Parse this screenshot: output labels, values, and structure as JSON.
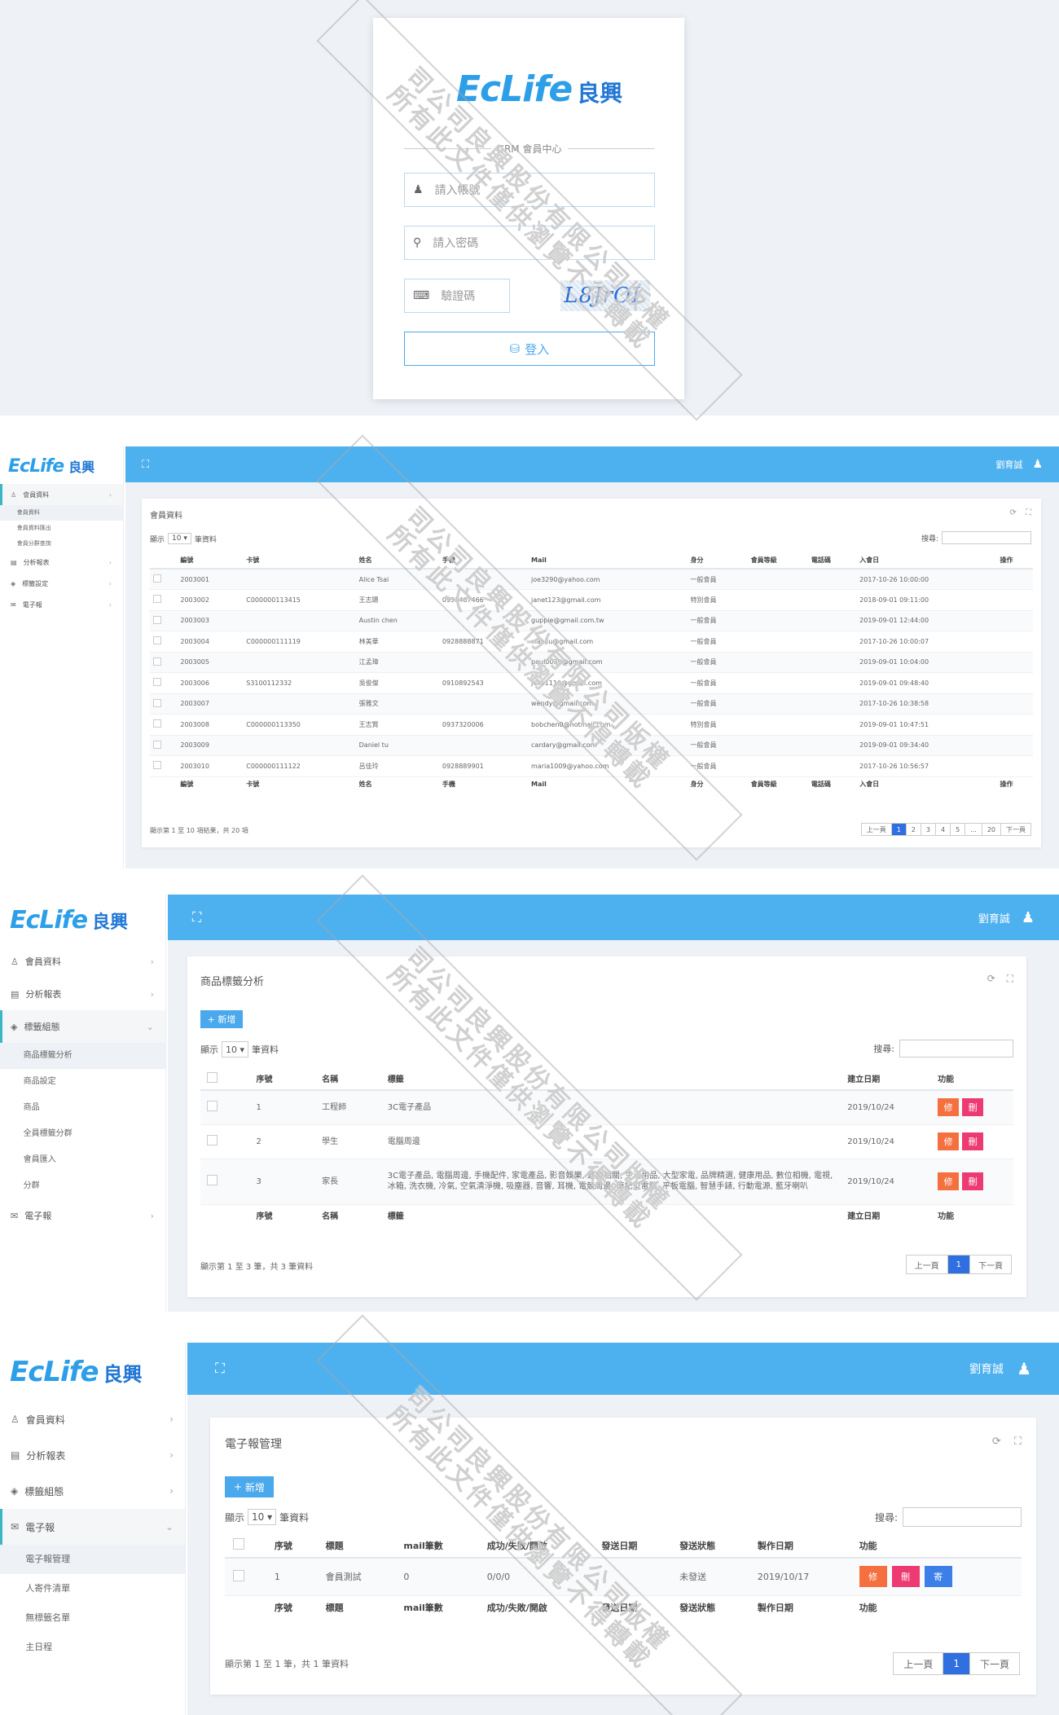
{
  "watermark": {
    "line1": "司公司良興股份有限公司版權",
    "line2": "所有此文件僅供瀏覽不得轉載"
  },
  "login": {
    "logo_en": "EcLife",
    "logo_zh": "良興",
    "section_label": "CRM 會員中心",
    "account_placeholder": "請入帳號",
    "password_placeholder": "請入密碼",
    "captcha_placeholder": "驗證碼",
    "captcha_text": "L8JrOL",
    "login_button": "登入"
  },
  "common": {
    "logo_en": "EcLife",
    "logo_zh": "良興",
    "user_name": "劉育誠"
  },
  "panel2": {
    "menu": [
      {
        "label": "會員資料",
        "active": true
      },
      {
        "label": "分析報表"
      },
      {
        "label": "標籤設定"
      },
      {
        "label": "電子報"
      }
    ],
    "submenu": [
      "會員資料",
      "會員資料匯出",
      "會員分群查詢"
    ],
    "card_title": "會員資料",
    "show_prefix": "顯示",
    "show_value": "10",
    "show_suffix": "筆資料",
    "search_label": "搜尋:",
    "columns": [
      "",
      "編號",
      "卡號",
      "姓名",
      "手機",
      "Mail",
      "身分",
      "會員等級",
      "電話碼",
      "入會日",
      "操作"
    ],
    "footer_columns": [
      "",
      "編號",
      "卡號",
      "姓名",
      "手機",
      "Mail",
      "身分",
      "會員等級",
      "電話碼",
      "入會日",
      "操作"
    ],
    "rows": [
      [
        "",
        "2003001",
        "",
        "Alice Tsai",
        "",
        "joe3290@yahoo.com",
        "一般會員",
        "",
        "",
        "2017-10-26 10:00:00",
        ""
      ],
      [
        "",
        "2003002",
        "C000000113415",
        "王志聰",
        "0933467466",
        "janet123@gmail.com",
        "特別會員",
        "",
        "",
        "2018-09-01 09:11:00",
        ""
      ],
      [
        "",
        "2003003",
        "",
        "Austin chen",
        "",
        "guppie@gmail.com.tw",
        "一般會員",
        "",
        "",
        "2019-09-01 12:44:00",
        ""
      ],
      [
        "",
        "2003004",
        "C000000111119",
        "林美華",
        "0928888871",
        "xiaoliu@gmail.com",
        "一般會員",
        "",
        "",
        "2017-10-26 10:00:07",
        ""
      ],
      [
        "",
        "2003005",
        "",
        "江孟璋",
        "",
        "paul0030@gmail.com",
        "一般會員",
        "",
        "",
        "2019-09-01 10:04:00",
        ""
      ],
      [
        "",
        "2003006",
        "S3100112332",
        "吳俊傑",
        "0910892543",
        "julia1110@gmail.com",
        "一般會員",
        "",
        "",
        "2019-09-01 09:48:40",
        ""
      ],
      [
        "",
        "2003007",
        "",
        "張雅文",
        "",
        "wendy@gmail.com",
        "一般會員",
        "",
        "",
        "2017-10-26 10:38:58",
        ""
      ],
      [
        "",
        "2003008",
        "C000000113350",
        "王志賢",
        "0937320006",
        "bobchen0@hotmail.com",
        "特別會員",
        "",
        "",
        "2019-09-01 10:47:51",
        ""
      ],
      [
        "",
        "2003009",
        "",
        "Daniel tu",
        "",
        "cardary@gmail.com",
        "一般會員",
        "",
        "",
        "2019-09-01 09:34:40",
        ""
      ],
      [
        "",
        "2003010",
        "C000000111122",
        "呂佳玲",
        "0928889901",
        "maria1009@yahoo.com",
        "一般會員",
        "",
        "",
        "2017-10-26 10:56:57",
        ""
      ]
    ],
    "info": "顯示第 1 至 10 項結果，共 20 項",
    "pages": [
      "上一頁",
      "1",
      "2",
      "3",
      "4",
      "5",
      "...",
      "20",
      "下一頁"
    ]
  },
  "panel3": {
    "menu": [
      {
        "label": "會員資料"
      },
      {
        "label": "分析報表"
      },
      {
        "label": "標籤組態",
        "active": true,
        "open": true
      },
      {
        "label": "電子報"
      }
    ],
    "submenu": [
      "商品標籤分析",
      "商品設定",
      "商品",
      "全員標籤分群",
      "會員匯入",
      "分群"
    ],
    "card_title": "商品標籤分析",
    "add_button": "新增",
    "show_prefix": "顯示",
    "show_value": "10",
    "show_suffix": "筆資料",
    "search_label": "搜尋:",
    "columns": [
      "",
      "序號",
      "名稱",
      "標籤",
      "建立日期",
      "功能"
    ],
    "footer_columns": [
      "",
      "序號",
      "名稱",
      "標籤",
      "建立日期",
      "功能"
    ],
    "rows": [
      {
        "no": "1",
        "name": "工程師",
        "tags": "3C電子產品",
        "date": "2019/10/24"
      },
      {
        "no": "2",
        "name": "學生",
        "tags": "電腦周邊",
        "date": "2019/10/24"
      },
      {
        "no": "3",
        "name": "家長",
        "tags": "3C電子產品, 電腦周邊, 手機配件, 家電產品, 影音娛樂, 遊戲相關, 生活用品, 大型家電, 品牌精選, 健康用品, 數位相機, 電視, 冰箱, 洗衣機, 冷氣, 空氣清淨機, 吸塵器, 音響, 耳機, 電競周邊, 筆記型電腦, 平板電腦, 智慧手錶, 行動電源, 藍牙喇叭",
        "date": "2019/10/24"
      }
    ],
    "edit_label": "修",
    "delete_label": "刪",
    "info": "顯示第 1 至 3 筆，共 3 筆資料",
    "pages": [
      "上一頁",
      "1",
      "下一頁"
    ]
  },
  "panel4": {
    "menu": [
      {
        "label": "會員資料"
      },
      {
        "label": "分析報表"
      },
      {
        "label": "標籤組態"
      },
      {
        "label": "電子報",
        "active": true,
        "open": true
      }
    ],
    "submenu": [
      "電子報管理",
      "人寄件清單",
      "無標籤名單",
      "主日程"
    ],
    "card_title": "電子報管理",
    "add_button": "新增",
    "show_prefix": "顯示",
    "show_value": "10",
    "show_suffix": "筆資料",
    "search_label": "搜尋:",
    "columns": [
      "",
      "序號",
      "標題",
      "mail筆數",
      "成功/失敗/開啟",
      "發送日期",
      "發送狀態",
      "製作日期",
      "功能"
    ],
    "footer_columns": [
      "",
      "序號",
      "標題",
      "mail筆數",
      "成功/失敗/開啟",
      "發送日期",
      "發送狀態",
      "製作日期",
      "功能"
    ],
    "rows": [
      {
        "no": "1",
        "title": "會員測試",
        "count": "0",
        "ratio": "0/0/0",
        "send_date": "",
        "status": "未發送",
        "made": "2019/10/17"
      }
    ],
    "action_labels": [
      "修",
      "刪",
      "寄"
    ],
    "info": "顯示第 1 至 1 筆，共 1 筆資料",
    "pages": [
      "上一頁",
      "1",
      "下一頁"
    ]
  },
  "colors": {
    "topbar": "#4db0ef",
    "primary": "#2f6fe0",
    "edit": "#f5703f",
    "delete": "#ee3a72",
    "send": "#3c7fe8",
    "active_border": "#3cb6c4"
  }
}
